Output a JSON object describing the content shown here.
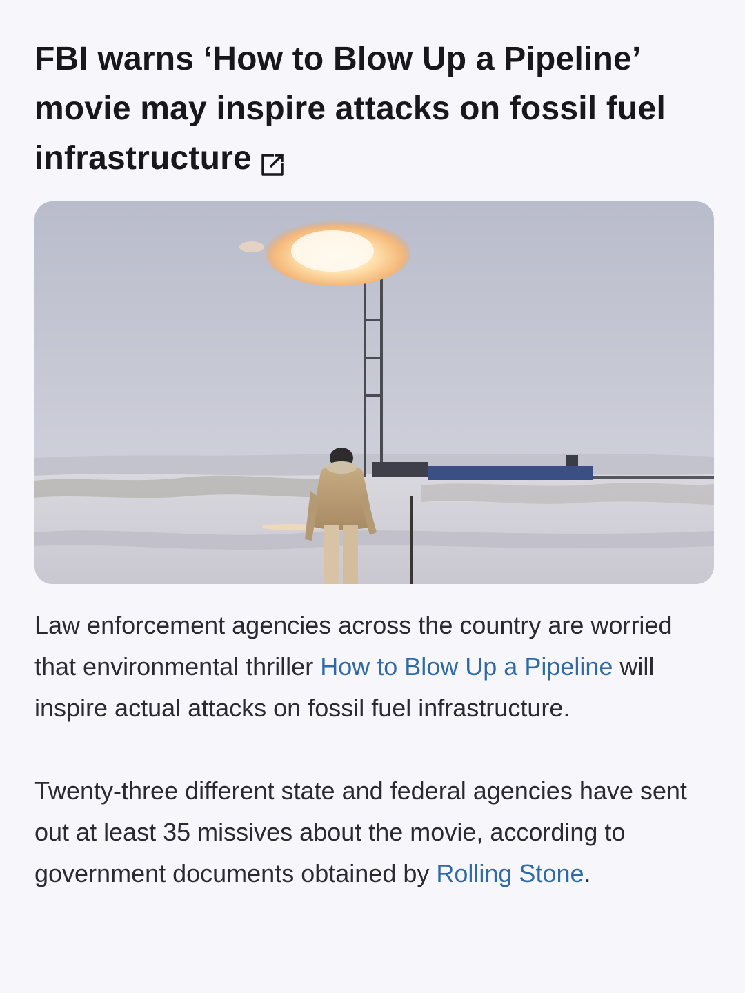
{
  "article": {
    "headline": "FBI warns ‘How to Blow Up a Pipeline’ movie may inspire attacks on fossil fuel infrastructure",
    "external_link_icon": "external-link-icon",
    "image_alt": "Person in a tan parka walking across snowy field toward a gas flare stack",
    "paragraph1": {
      "before_link": "Law enforcement agencies across the country are worried that environmental thriller ",
      "link_text": "How to Blow Up a Pipeline",
      "after_link": " will inspire actual attacks on fossil fuel infrastructure."
    },
    "paragraph2": {
      "before_link": "Twenty-three different state and federal agencies have sent out at least 35 missives about the movie, according to government documents obtained by ",
      "link_text": "Rolling Stone",
      "after_link": "."
    }
  },
  "colors": {
    "background": "#f6f6fb",
    "text": "#17171c",
    "link": "#2f6aa6"
  }
}
